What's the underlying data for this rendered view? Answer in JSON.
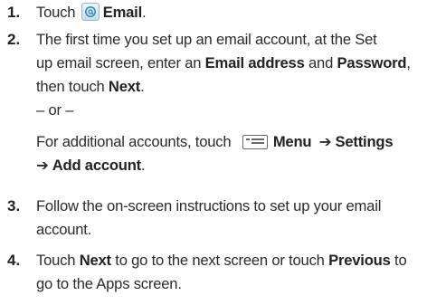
{
  "steps": [
    {
      "number": "1.",
      "touch": "Touch",
      "email": "Email",
      "period": "."
    },
    {
      "number": "2.",
      "line1": "The first time you set up an email account, at the Set",
      "line2_a": "up email screen, enter an",
      "email_address": "Email address",
      "and": "and",
      "password": "Password",
      "comma": ",",
      "then_touch": "then touch",
      "next": "Next",
      "period": ".",
      "or": "– or –",
      "additional": "For additional accounts, touch",
      "menu": "Menu",
      "arrow": "➔",
      "settings": "Settings",
      "add_account": "Add account",
      "period2": "."
    },
    {
      "number": "3.",
      "line1": "Follow the on-screen instructions to set up your email",
      "line2": "account."
    },
    {
      "number": "4.",
      "touch": "Touch",
      "next": "Next",
      "mid": "to go to the next screen or touch",
      "previous": "Previous",
      "to": "to",
      "line2": "go to the Apps screen."
    }
  ]
}
